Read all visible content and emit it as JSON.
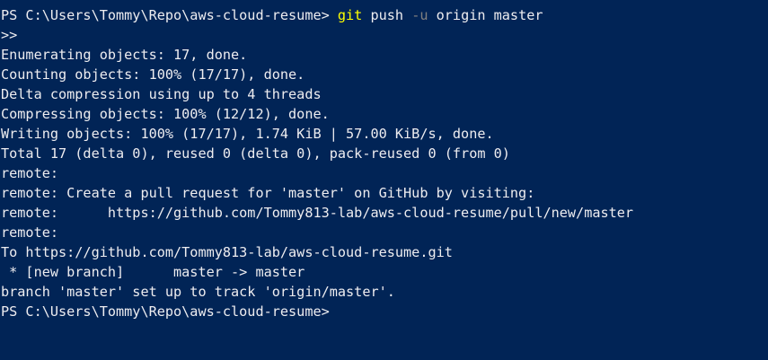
{
  "terminal": {
    "partial_top_text": "master",
    "prompt": "PS C:\\Users\\Tommy\\Repo\\aws-cloud-resume> ",
    "command": {
      "program": "git",
      "args1": " push ",
      "flag": "-u",
      "args2": " origin master"
    },
    "output_lines": [
      ">>",
      "Enumerating objects: 17, done.",
      "Counting objects: 100% (17/17), done.",
      "Delta compression using up to 4 threads",
      "Compressing objects: 100% (12/12), done.",
      "Writing objects: 100% (17/17), 1.74 KiB | 57.00 KiB/s, done.",
      "Total 17 (delta 0), reused 0 (delta 0), pack-reused 0 (from 0)",
      "remote:",
      "remote: Create a pull request for 'master' on GitHub by visiting:",
      "remote:      https://github.com/Tommy813-lab/aws-cloud-resume/pull/new/master",
      "remote:",
      "To https://github.com/Tommy813-lab/aws-cloud-resume.git",
      " * [new branch]      master -> master",
      "branch 'master' set up to track 'origin/master'."
    ],
    "final_prompt": "PS C:\\Users\\Tommy\\Repo\\aws-cloud-resume>",
    "colors": {
      "background": "#012456",
      "foreground": "#eeedf0",
      "command": "#ffff00",
      "parameter": "#808080"
    }
  }
}
